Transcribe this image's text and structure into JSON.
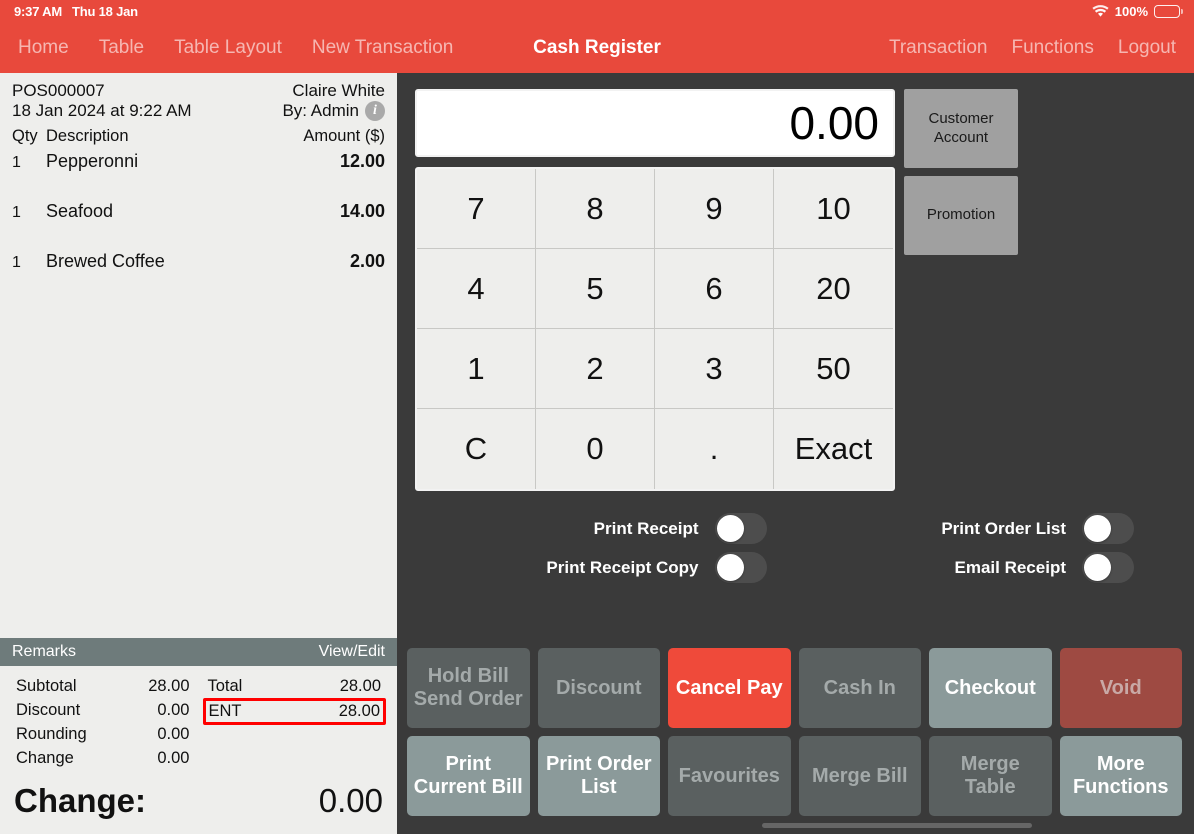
{
  "statusbar": {
    "time": "9:37 AM",
    "date": "Thu 18 Jan",
    "battery_percent": "100%",
    "wifi_icon": "wifi-icon",
    "battery_icon": "battery-icon"
  },
  "navbar": {
    "title": "Cash Register",
    "left_items": [
      {
        "label": "Home"
      },
      {
        "label": "Table"
      },
      {
        "label": "Table Layout"
      },
      {
        "label": "New Transaction"
      }
    ],
    "right_items": [
      {
        "label": "Transaction"
      },
      {
        "label": "Functions"
      },
      {
        "label": "Logout"
      }
    ],
    "accent_color": "#e8493c"
  },
  "receipt": {
    "order_id": "POS000007",
    "customer": "Claire White",
    "datetime": "18 Jan 2024 at 9:22 AM",
    "by": "By: Admin",
    "info_icon": "info-icon",
    "columns": {
      "qty": "Qty",
      "description": "Description",
      "amount": "Amount ($)"
    },
    "items": [
      {
        "qty": "1",
        "description": "Pepperonni",
        "amount": "12.00"
      },
      {
        "qty": "1",
        "description": "Seafood",
        "amount": "14.00"
      },
      {
        "qty": "1",
        "description": "Brewed Coffee",
        "amount": "2.00"
      }
    ],
    "remarks": {
      "label": "Remarks",
      "action": "View/Edit"
    },
    "totals_left": [
      {
        "label": "Subtotal",
        "value": "28.00"
      },
      {
        "label": "Discount",
        "value": "0.00"
      },
      {
        "label": "Rounding",
        "value": "0.00"
      },
      {
        "label": "Change",
        "value": "0.00"
      }
    ],
    "totals_right": [
      {
        "label": "Total",
        "value": "28.00",
        "highlighted": false
      },
      {
        "label": "ENT",
        "value": "28.00",
        "highlighted": true
      }
    ],
    "highlight_color": "#ff0000",
    "change": {
      "label": "Change:",
      "value": "0.00"
    }
  },
  "register": {
    "display_value": "0.00",
    "keypad": [
      "7",
      "8",
      "9",
      "10",
      "4",
      "5",
      "6",
      "20",
      "1",
      "2",
      "3",
      "50",
      "C",
      "0",
      ".",
      "Exact"
    ],
    "side_buttons": [
      {
        "label": "Customer Account"
      },
      {
        "label": "Promotion"
      }
    ],
    "toggles": [
      {
        "label": "Print Receipt",
        "on": false
      },
      {
        "label": "Print Order List",
        "on": false
      },
      {
        "label": "Print Receipt Copy",
        "on": false
      },
      {
        "label": "Email Receipt",
        "on": false
      }
    ]
  },
  "actions": [
    {
      "label": "Hold Bill Send Order",
      "style": "disabled"
    },
    {
      "label": "Discount",
      "style": "disabled"
    },
    {
      "label": "Cancel Pay",
      "style": "red"
    },
    {
      "label": "Cash In",
      "style": "disabled"
    },
    {
      "label": "Checkout",
      "style": "teal"
    },
    {
      "label": "Void",
      "style": "darkred"
    },
    {
      "label": "Print Current Bill",
      "style": "teal"
    },
    {
      "label": "Print Order List",
      "style": "teal"
    },
    {
      "label": "Favourites",
      "style": "disabled"
    },
    {
      "label": "Merge Bill",
      "style": "disabled"
    },
    {
      "label": "Merge Table",
      "style": "disabled"
    },
    {
      "label": "More Functions",
      "style": "teal"
    }
  ]
}
